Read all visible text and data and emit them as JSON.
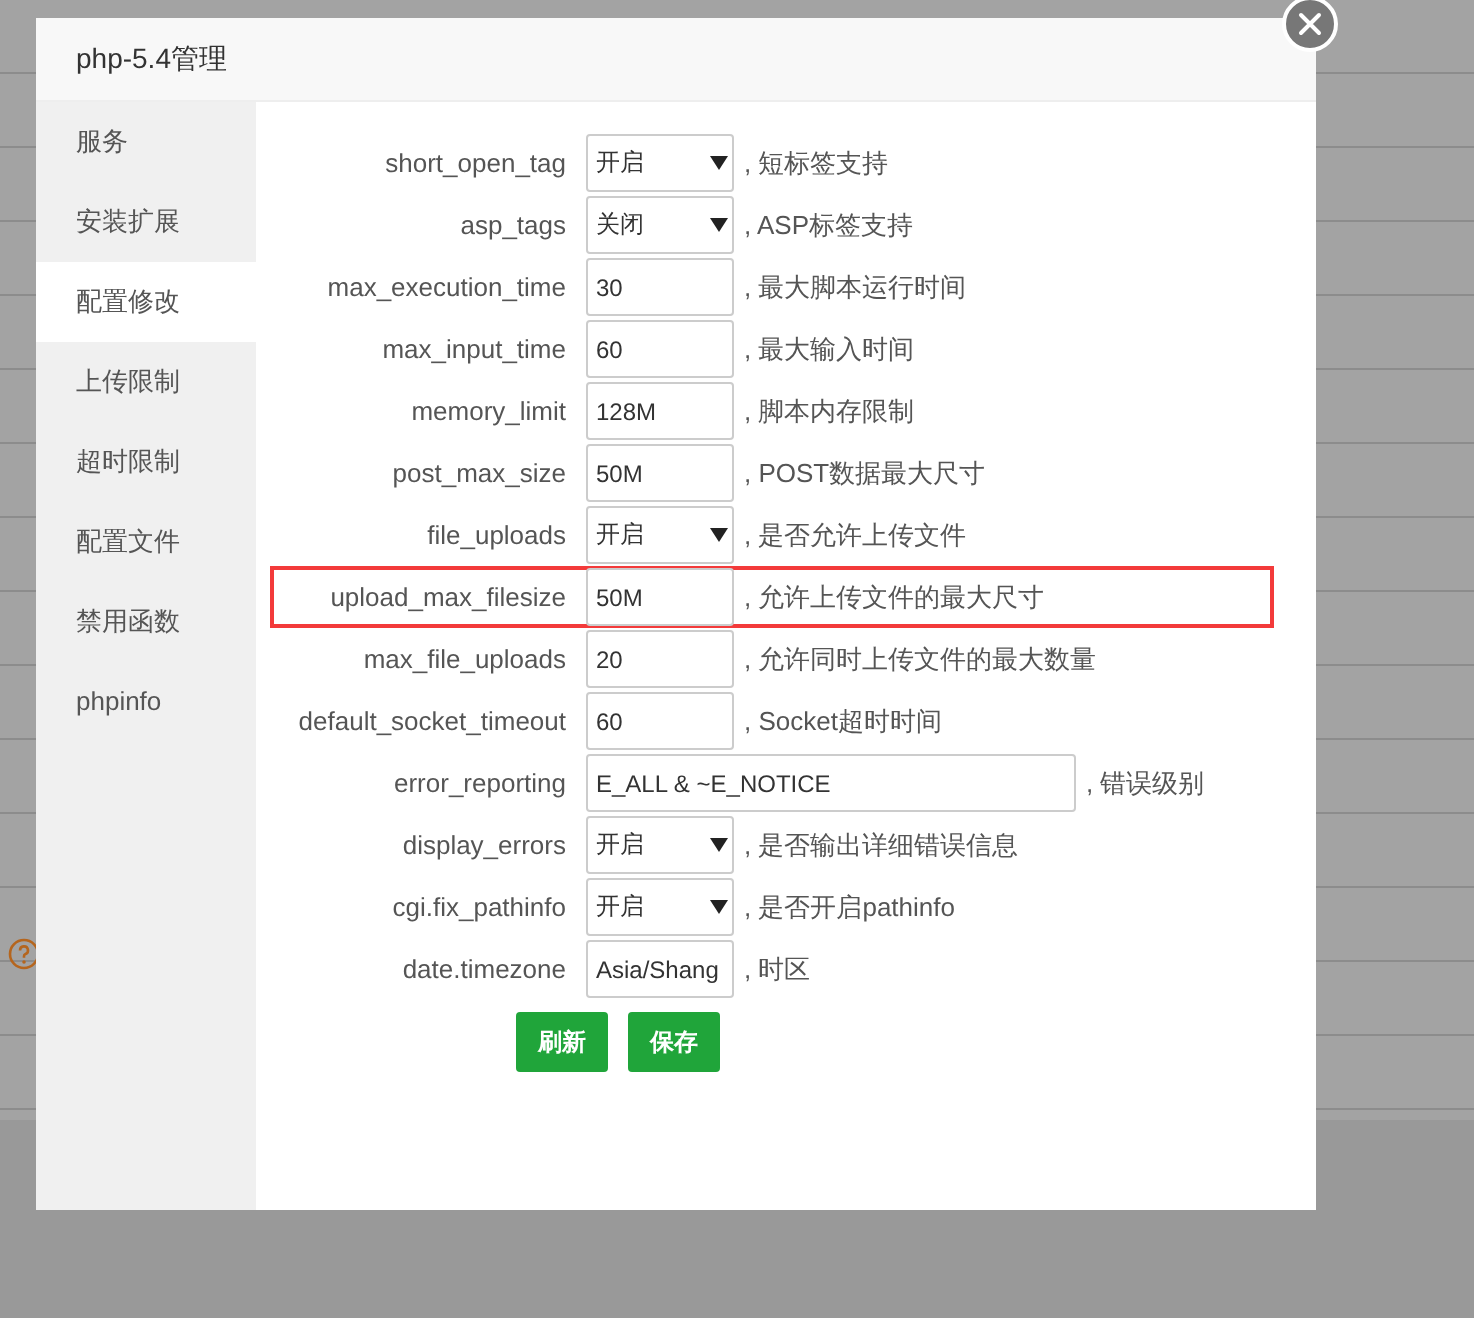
{
  "dialog": {
    "title": "php-5.4管理"
  },
  "sidebar": {
    "items": [
      {
        "label": "服务",
        "selected": false
      },
      {
        "label": "安装扩展",
        "selected": false
      },
      {
        "label": "配置修改",
        "selected": true
      },
      {
        "label": "上传限制",
        "selected": false
      },
      {
        "label": "超时限制",
        "selected": false
      },
      {
        "label": "配置文件",
        "selected": false
      },
      {
        "label": "禁用函数",
        "selected": false
      },
      {
        "label": "phpinfo",
        "selected": false
      }
    ]
  },
  "fields": [
    {
      "label": "short_open_tag",
      "kind": "select",
      "value": "开启",
      "hint": ", 短标签支持",
      "highlighted": false
    },
    {
      "label": "asp_tags",
      "kind": "select",
      "value": "关闭",
      "hint": ", ASP标签支持",
      "highlighted": false
    },
    {
      "label": "max_execution_time",
      "kind": "input",
      "value": "30",
      "hint": ", 最大脚本运行时间",
      "highlighted": false
    },
    {
      "label": "max_input_time",
      "kind": "input",
      "value": "60",
      "hint": ", 最大输入时间",
      "highlighted": false
    },
    {
      "label": "memory_limit",
      "kind": "input",
      "value": "128M",
      "hint": ", 脚本内存限制",
      "highlighted": false
    },
    {
      "label": "post_max_size",
      "kind": "input",
      "value": "50M",
      "hint": ", POST数据最大尺寸",
      "highlighted": false
    },
    {
      "label": "file_uploads",
      "kind": "select",
      "value": "开启",
      "hint": ", 是否允许上传文件",
      "highlighted": false
    },
    {
      "label": "upload_max_filesize",
      "kind": "input",
      "value": "50M",
      "hint": ", 允许上传文件的最大尺寸",
      "highlighted": true
    },
    {
      "label": "max_file_uploads",
      "kind": "input",
      "value": "20",
      "hint": ", 允许同时上传文件的最大数量",
      "highlighted": false
    },
    {
      "label": "default_socket_timeout",
      "kind": "input",
      "value": "60",
      "hint": ", Socket超时时间",
      "highlighted": false
    },
    {
      "label": "error_reporting",
      "kind": "wide",
      "value": "E_ALL & ~E_NOTICE",
      "hint": ", 错误级别",
      "highlighted": false
    },
    {
      "label": "display_errors",
      "kind": "select",
      "value": "开启",
      "hint": ", 是否输出详细错误信息",
      "highlighted": false
    },
    {
      "label": "cgi.fix_pathinfo",
      "kind": "select",
      "value": "开启",
      "hint": ", 是否开启pathinfo",
      "highlighted": false
    },
    {
      "label": "date.timezone",
      "kind": "input",
      "value": "Asia/Shang",
      "hint": ", 时区",
      "highlighted": false
    }
  ],
  "buttons": [
    "刷新",
    "保存"
  ]
}
